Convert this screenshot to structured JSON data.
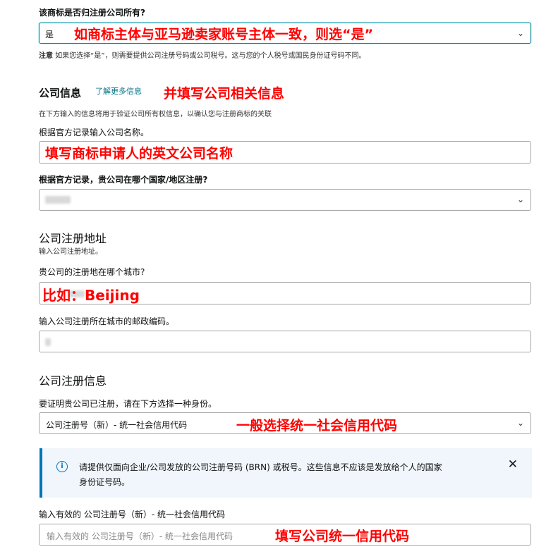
{
  "q_ownership": {
    "label": "该商标是否归注册公司所有?",
    "selected": "是",
    "annotation": "如商标主体与亚马逊卖家账号主体一致，则选“是”",
    "note_prefix": "注意",
    "note_text": "如果您选择“是”，则需要提供公司注册号码或公司税号。这与您的个人税号或国民身份证号码不同。"
  },
  "company_info": {
    "title": "公司信息",
    "learn_more": "了解更多信息",
    "annotation": "并填写公司相关信息",
    "subtitle": "在下方输入的信息将用于验证公司所有权信息，以确认您与注册商标的关联",
    "name_label": "根据官方记录输入公司名称。",
    "name_annotation": "填写商标申请人的英文公司名称",
    "country_label": "根据官方记录，贵公司在哪个国家/地区注册?"
  },
  "address": {
    "title": "公司注册地址",
    "subtitle": "输入公司注册地址。",
    "city_label": "贵公司的注册地在哪个城市?",
    "city_annotation": "比如：Beijing",
    "zip_label": "输入公司注册所在城市的邮政编码。"
  },
  "registration": {
    "title": "公司注册信息",
    "id_label": "要证明贵公司已注册，请在下方选择一种身份。",
    "id_selected": "公司注册号（新）- 统一社会信用代码",
    "id_annotation": "一般选择统一社会信用代码",
    "info_text_1": "请提供仅面向企业/公司发放的公司注册号码 (BRN) 或税号。这些信息不应该是发放给个人的国家",
    "info_text_2": "身份证号码。",
    "number_label": "输入有效的 公司注册号（新）- 统一社会信用代码",
    "number_placeholder": "输入有效的 公司注册号（新）- 统一社会信用代码",
    "number_annotation": "填写公司统一信用代码"
  },
  "icons": {
    "chevron": "chevron-down-icon",
    "info": "info-icon",
    "close": "close-icon"
  },
  "colors": {
    "annotation": "#ff0000",
    "link": "#007185",
    "focus_border": "#008296",
    "info_bar": "#0073bb",
    "info_bg": "#f0f6fb"
  }
}
